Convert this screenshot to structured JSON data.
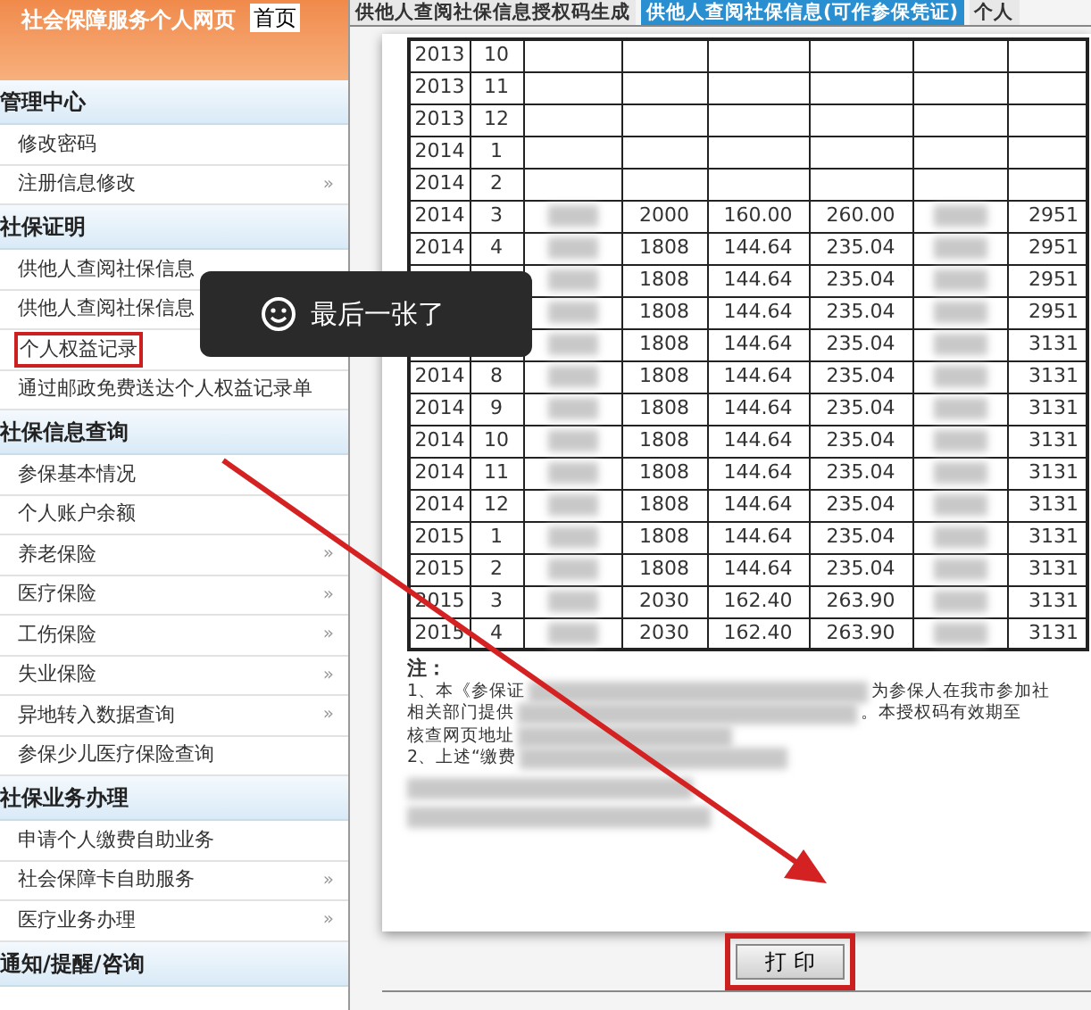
{
  "header": {
    "site_title": "社会保障服务个人网页",
    "home_button": "首页"
  },
  "sidebar": {
    "sections": [
      {
        "title": "管理中心",
        "items": [
          {
            "label": "修改密码",
            "submenu": false,
            "highlighted": false
          },
          {
            "label": "注册信息修改",
            "submenu": true,
            "highlighted": false
          }
        ]
      },
      {
        "title": "社保证明",
        "items": [
          {
            "label": "供他人查阅社保信息",
            "submenu": false,
            "highlighted": false
          },
          {
            "label": "供他人查阅社保信息",
            "submenu": false,
            "highlighted": false
          },
          {
            "label": "个人权益记录",
            "submenu": false,
            "highlighted": true
          },
          {
            "label": "通过邮政免费送达个人权益记录单",
            "submenu": false,
            "highlighted": false
          }
        ]
      },
      {
        "title": "社保信息查询",
        "items": [
          {
            "label": "参保基本情况",
            "submenu": false,
            "highlighted": false
          },
          {
            "label": "个人账户余额",
            "submenu": false,
            "highlighted": false
          },
          {
            "label": "养老保险",
            "submenu": true,
            "highlighted": false
          },
          {
            "label": "医疗保险",
            "submenu": true,
            "highlighted": false
          },
          {
            "label": "工伤保险",
            "submenu": true,
            "highlighted": false
          },
          {
            "label": "失业保险",
            "submenu": true,
            "highlighted": false
          },
          {
            "label": "异地转入数据查询",
            "submenu": true,
            "highlighted": false
          },
          {
            "label": "参保少儿医疗保险查询",
            "submenu": false,
            "highlighted": false
          }
        ]
      },
      {
        "title": "社保业务办理",
        "items": [
          {
            "label": "申请个人缴费自助业务",
            "submenu": false,
            "highlighted": false
          },
          {
            "label": "社会保障卡自助服务",
            "submenu": true,
            "highlighted": false
          },
          {
            "label": "医疗业务办理",
            "submenu": true,
            "highlighted": false
          }
        ]
      },
      {
        "title": "通知/提醒/咨询"
      }
    ]
  },
  "submenu_mark": "»",
  "tabs": [
    {
      "label": "供他人查阅社保信息授权码生成",
      "selected": false
    },
    {
      "label": "供他人查阅社保信息(可作参保凭证)",
      "selected": true
    },
    {
      "label": "个人",
      "selected": false
    }
  ],
  "table": {
    "rows": [
      {
        "year": "2013",
        "month": "10",
        "redacted": false
      },
      {
        "year": "2013",
        "month": "11",
        "redacted": false
      },
      {
        "year": "2013",
        "month": "12",
        "redacted": false
      },
      {
        "year": "2014",
        "month": "1",
        "redacted": false
      },
      {
        "year": "2014",
        "month": "2",
        "redacted": false
      },
      {
        "year": "2014",
        "month": "3",
        "redacted": true,
        "column_4": "2000",
        "column_5": "160.00",
        "column_6": "260.00",
        "column_8": "2951"
      },
      {
        "year": "2014",
        "month": "4",
        "redacted": true,
        "column_4": "1808",
        "column_5": "144.64",
        "column_6": "235.04",
        "column_8": "2951"
      },
      {
        "redacted": true,
        "column_4": "1808",
        "column_5": "144.64",
        "column_6": "235.04",
        "column_8": "2951"
      },
      {
        "redacted": true,
        "column_4": "1808",
        "column_5": "144.64",
        "column_6": "235.04",
        "column_8": "2951"
      },
      {
        "redacted": true,
        "column_4": "1808",
        "column_5": "144.64",
        "column_6": "235.04",
        "column_8": "3131"
      },
      {
        "year": "2014",
        "month": "8",
        "redacted": true,
        "column_4": "1808",
        "column_5": "144.64",
        "column_6": "235.04",
        "column_8": "3131"
      },
      {
        "year": "2014",
        "month": "9",
        "redacted": true,
        "column_4": "1808",
        "column_5": "144.64",
        "column_6": "235.04",
        "column_8": "3131"
      },
      {
        "year": "2014",
        "month": "10",
        "redacted": true,
        "column_4": "1808",
        "column_5": "144.64",
        "column_6": "235.04",
        "column_8": "3131"
      },
      {
        "year": "2014",
        "month": "11",
        "redacted": true,
        "column_4": "1808",
        "column_5": "144.64",
        "column_6": "235.04",
        "column_8": "3131"
      },
      {
        "year": "2014",
        "month": "12",
        "redacted": true,
        "column_4": "1808",
        "column_5": "144.64",
        "column_6": "235.04",
        "column_8": "3131"
      },
      {
        "year": "2015",
        "month": "1",
        "redacted": true,
        "column_4": "1808",
        "column_5": "144.64",
        "column_6": "235.04",
        "column_8": "3131"
      },
      {
        "year": "2015",
        "month": "2",
        "redacted": true,
        "column_4": "1808",
        "column_5": "144.64",
        "column_6": "235.04",
        "column_8": "3131"
      },
      {
        "year": "2015",
        "month": "3",
        "redacted": true,
        "column_4": "2030",
        "column_5": "162.40",
        "column_6": "263.90",
        "column_8": "3131"
      },
      {
        "year": "2015",
        "month": "4",
        "redacted": true,
        "column_4": "2030",
        "column_5": "162.40",
        "column_6": "263.90",
        "column_8": "3131"
      }
    ]
  },
  "notes": {
    "title": "注：",
    "lines": [
      {
        "start": "1、本《参保证",
        "end": "为参保人在我市参加社"
      },
      {
        "start": "相关部门提供",
        "end": "。本授权码有效期至"
      },
      {
        "start": "核查网页地址"
      },
      {
        "start": "2、上述“缴费"
      }
    ]
  },
  "print_button": {
    "label": "打 印",
    "highlighted": true
  },
  "toast": {
    "message": "最后一张了"
  }
}
